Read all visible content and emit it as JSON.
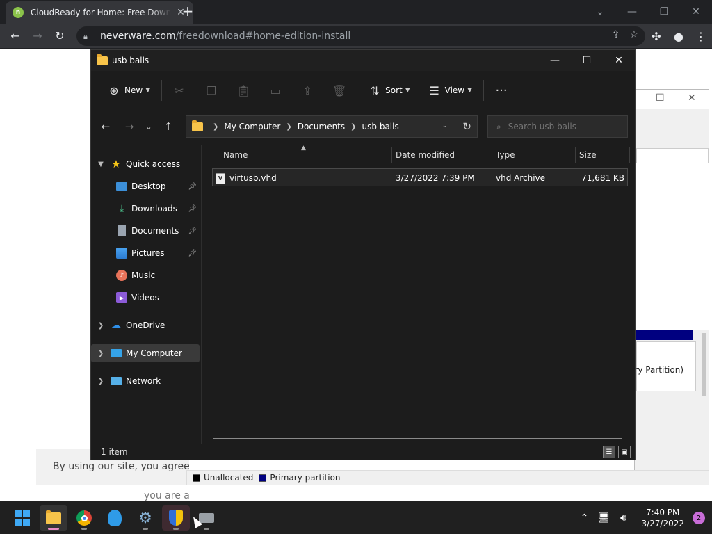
{
  "browser": {
    "tab_title": "CloudReady for Home: Free Download",
    "favicon_letter": "n",
    "url_host": "neverware.com",
    "url_path": "/freedownload#home-edition-install"
  },
  "site": {
    "cookie_text": "By using our site, you agree to",
    "cookie_subtext": "you are a"
  },
  "disk_management": {
    "partition_label": "(Recovery Partition)",
    "legend": [
      {
        "label": "Unallocated",
        "color": "#000000"
      },
      {
        "label": "Primary partition",
        "color": "#000080"
      }
    ]
  },
  "explorer": {
    "window_title": "usb balls",
    "commands": {
      "new_label": "New",
      "sort_label": "Sort",
      "view_label": "View"
    },
    "breadcrumb": [
      "My Computer",
      "Documents",
      "usb balls"
    ],
    "search_placeholder": "Search usb balls",
    "sidebar": {
      "quick_access": "Quick access",
      "items": [
        {
          "label": "Desktop",
          "icon": "desktop-icon",
          "pinned": true
        },
        {
          "label": "Downloads",
          "icon": "download-icon",
          "pinned": true
        },
        {
          "label": "Documents",
          "icon": "document-icon",
          "pinned": true
        },
        {
          "label": "Pictures",
          "icon": "pictures-icon",
          "pinned": true
        },
        {
          "label": "Music",
          "icon": "music-icon",
          "pinned": false
        },
        {
          "label": "Videos",
          "icon": "videos-icon",
          "pinned": false
        }
      ],
      "onedrive": "OneDrive",
      "my_computer": "My Computer",
      "network": "Network"
    },
    "columns": {
      "name": "Name",
      "date_modified": "Date modified",
      "type": "Type",
      "size": "Size"
    },
    "files": [
      {
        "name": "virtusb.vhd",
        "date_modified": "3/27/2022 7:39 PM",
        "type": "vhd Archive",
        "size": "71,681 KB"
      }
    ],
    "status": "1 item"
  },
  "taskbar": {
    "time": "7:40 PM",
    "date": "3/27/2022",
    "notification_count": "2"
  },
  "colors": {
    "explorer_bg": "#1c1c1c",
    "folder": "#f8c44a",
    "accent_blue": "#3fa9f5",
    "primary_partition": "#000080"
  }
}
